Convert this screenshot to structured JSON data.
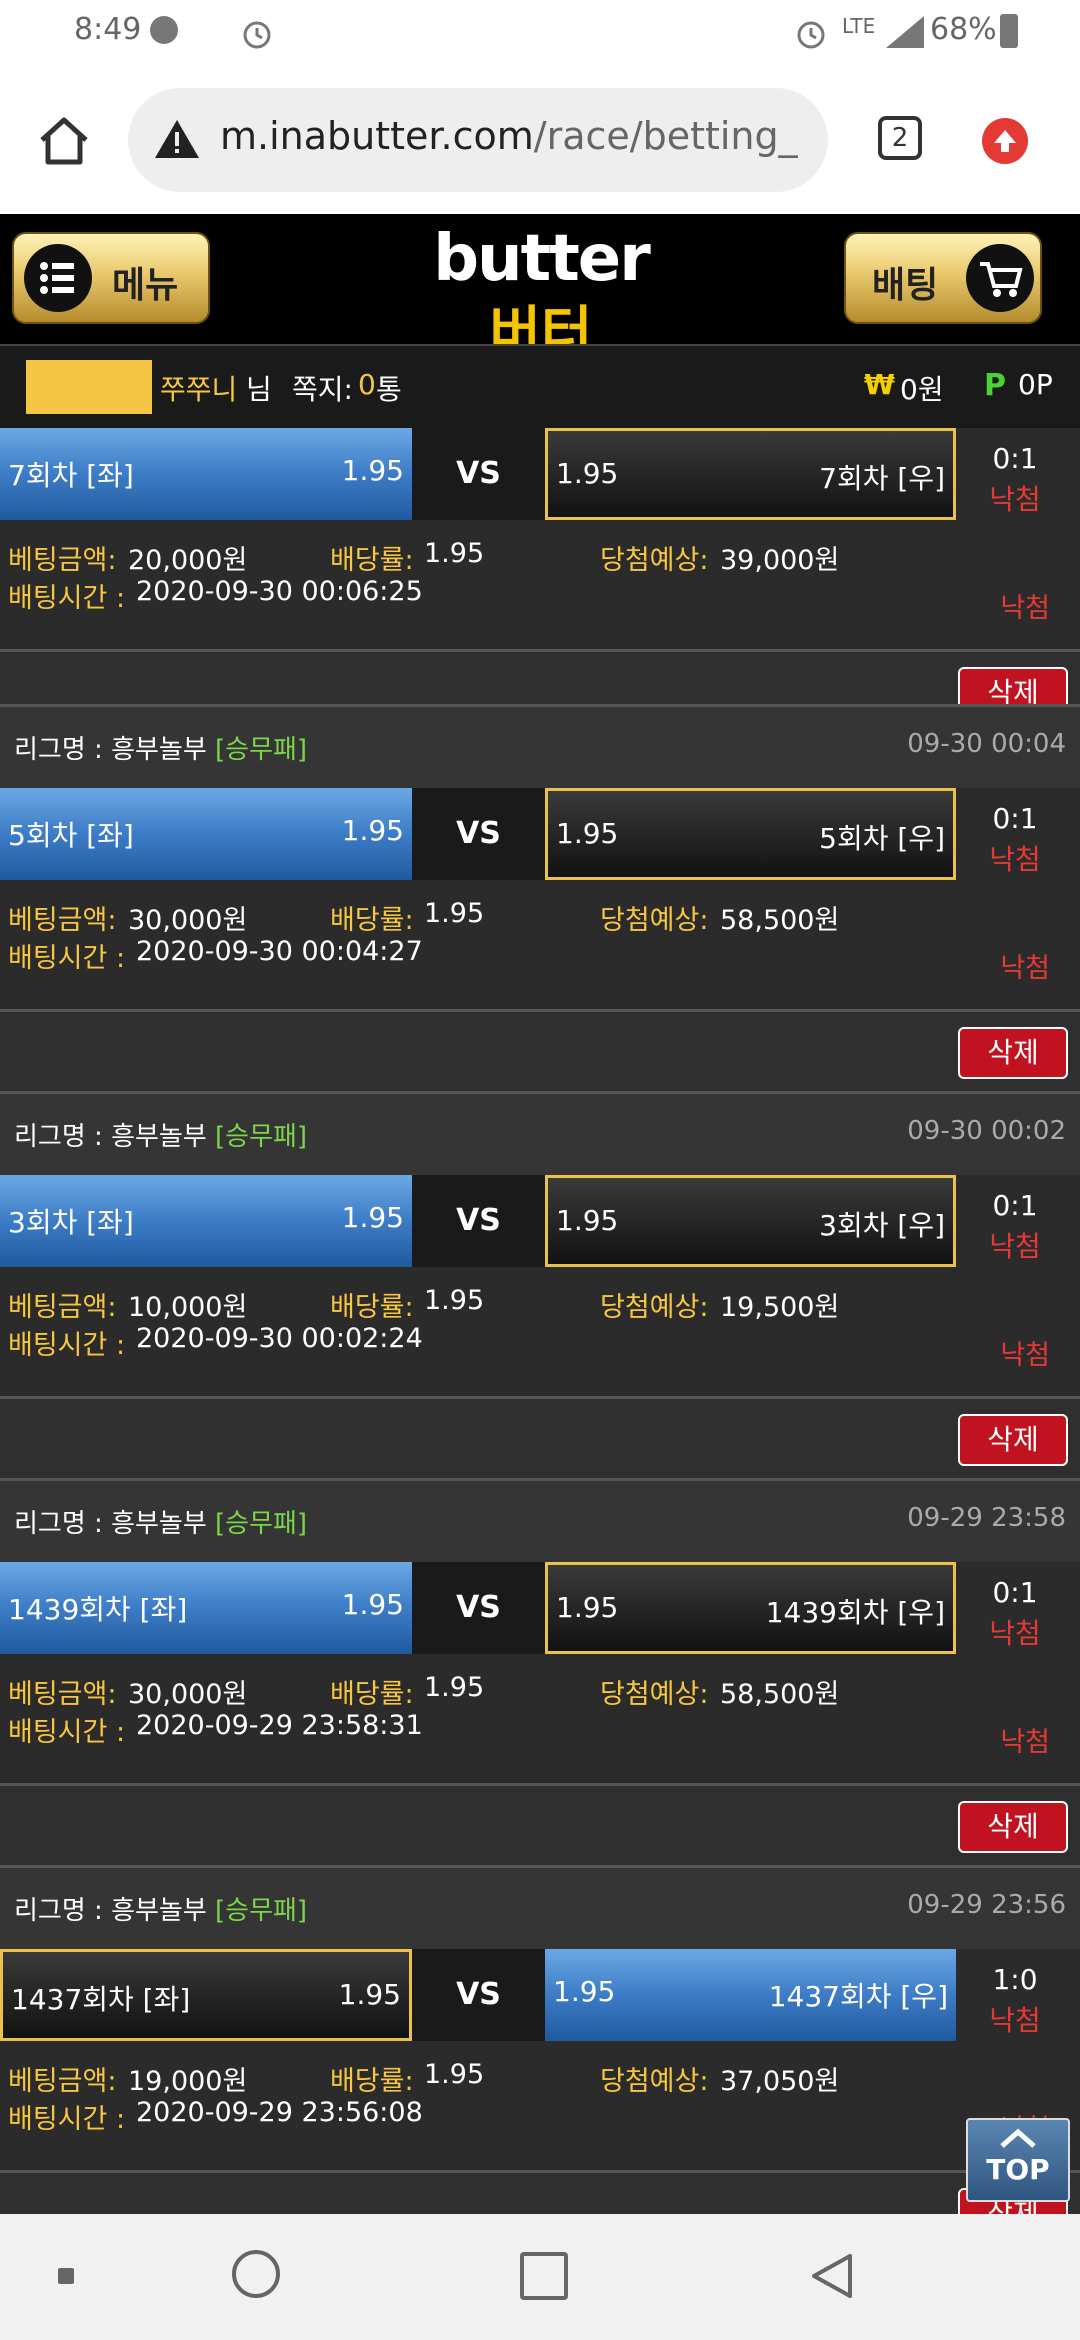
{
  "status_bar": {
    "time": "8:49",
    "network": "LTE",
    "battery": "68%"
  },
  "browser": {
    "url_host": "m.inabutter.com",
    "url_path": "/race/betting_",
    "tab_count": "2"
  },
  "header": {
    "menu_label": "메뉴",
    "betting_label": "배팅",
    "logo_en": "butter",
    "logo_ko": "버터"
  },
  "user_bar": {
    "name": "쭈쭈니",
    "suffix": "님",
    "message_label": "쪽지:",
    "message_count": "0",
    "message_unit": "통",
    "money_symbol": "₩",
    "money": "0원",
    "point_symbol": "P",
    "points": "0P"
  },
  "labels": {
    "league_prefix": "리그명 : ",
    "bet_amount": "베팅금액: ",
    "odds": "배당률: ",
    "expected_win": "당첨예상: ",
    "bet_time": "배팅시간 : ",
    "vs": "VS",
    "delete": "삭제",
    "top": "TOP"
  },
  "partial_top": {
    "left_team": "7회차 [좌]",
    "left_odds": "1.95",
    "right_odds": "1.95",
    "right_team": "7회차 [우]",
    "score": "0:1",
    "result": "낙첨",
    "amount": "20,000원",
    "odds": "1.95",
    "expected": "39,000원",
    "time": "2020-09-30 00:06:25",
    "result2": "낙첨"
  },
  "bets": [
    {
      "league": "흥부놀부",
      "type": "[승무패]",
      "datetime": "09-30 00:04",
      "left_team": "5회차 [좌]",
      "left_odds": "1.95",
      "right_odds": "1.95",
      "right_team": "5회차 [우]",
      "selected": "left",
      "score": "0:1",
      "result": "낙첨",
      "amount": "30,000원",
      "odds": "1.95",
      "expected": "58,500원",
      "time": "2020-09-30 00:04:27",
      "result2": "낙첨"
    },
    {
      "league": "흥부놀부",
      "type": "[승무패]",
      "datetime": "09-30 00:02",
      "left_team": "3회차 [좌]",
      "left_odds": "1.95",
      "right_odds": "1.95",
      "right_team": "3회차 [우]",
      "selected": "left",
      "score": "0:1",
      "result": "낙첨",
      "amount": "10,000원",
      "odds": "1.95",
      "expected": "19,500원",
      "time": "2020-09-30 00:02:24",
      "result2": "낙첨"
    },
    {
      "league": "흥부놀부",
      "type": "[승무패]",
      "datetime": "09-29 23:58",
      "left_team": "1439회차 [좌]",
      "left_odds": "1.95",
      "right_odds": "1.95",
      "right_team": "1439회차 [우]",
      "selected": "left",
      "score": "0:1",
      "result": "낙첨",
      "amount": "30,000원",
      "odds": "1.95",
      "expected": "58,500원",
      "time": "2020-09-29 23:58:31",
      "result2": "낙첨"
    },
    {
      "league": "흥부놀부",
      "type": "[승무패]",
      "datetime": "09-29 23:56",
      "left_team": "1437회차 [좌]",
      "left_odds": "1.95",
      "right_odds": "1.95",
      "right_team": "1437회차 [우]",
      "selected": "right",
      "score": "1:0",
      "result": "낙첨",
      "amount": "19,000원",
      "odds": "1.95",
      "expected": "37,050원",
      "time": "2020-09-29 23:56:08",
      "result2": "낙첨"
    }
  ],
  "colors": {
    "accent_gold": "#f7c640",
    "selected_blue": "#3d7cc6",
    "lose_red": "#e53935",
    "delete_red": "#c1121f"
  }
}
